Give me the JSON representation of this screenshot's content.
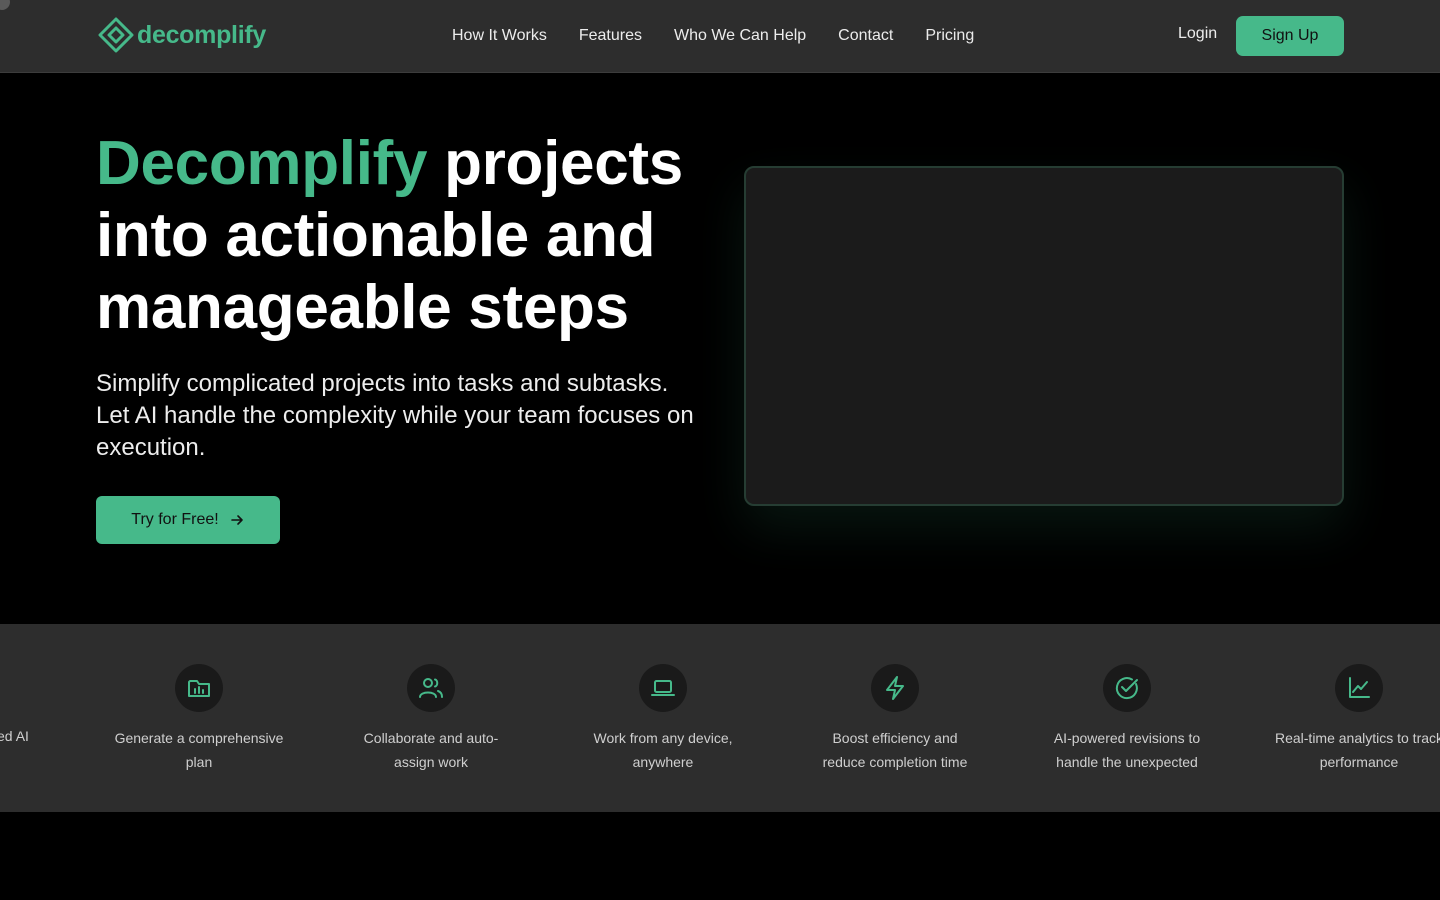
{
  "brand": {
    "name": "decomplify",
    "accent": "#46b98a"
  },
  "nav": {
    "links": [
      "How It Works",
      "Features",
      "Who We Can Help",
      "Contact",
      "Pricing"
    ],
    "login_label": "Login",
    "signup_label": "Sign Up"
  },
  "hero": {
    "title_accent": "Decomplify",
    "title_rest": "projects into actionable and manageable steps",
    "subtitle": "Simplify complicated projects into tasks and subtasks. Let AI handle the complexity while your team focuses on execution.",
    "cta_label": "Try for Free!",
    "cta_icon": "arrow-right-icon"
  },
  "features": {
    "partial_text": "ced AI",
    "items": [
      {
        "icon": "folder-chart-icon",
        "text": "Generate a comprehensive plan"
      },
      {
        "icon": "users-icon",
        "text": "Collaborate and auto-assign work"
      },
      {
        "icon": "laptop-icon",
        "text": "Work from any device, anywhere"
      },
      {
        "icon": "lightning-icon",
        "text": "Boost efficiency and reduce completion time"
      },
      {
        "icon": "check-circle-icon",
        "text": "AI-powered revisions to handle the unexpected"
      },
      {
        "icon": "line-chart-icon",
        "text": "Real-time analytics to track performance"
      }
    ]
  },
  "colors": {
    "nav_bg": "#2d2d2d",
    "page_bg": "#000000",
    "panel_bg": "#1b1b1b",
    "strip_bg": "#2d2d2d"
  }
}
